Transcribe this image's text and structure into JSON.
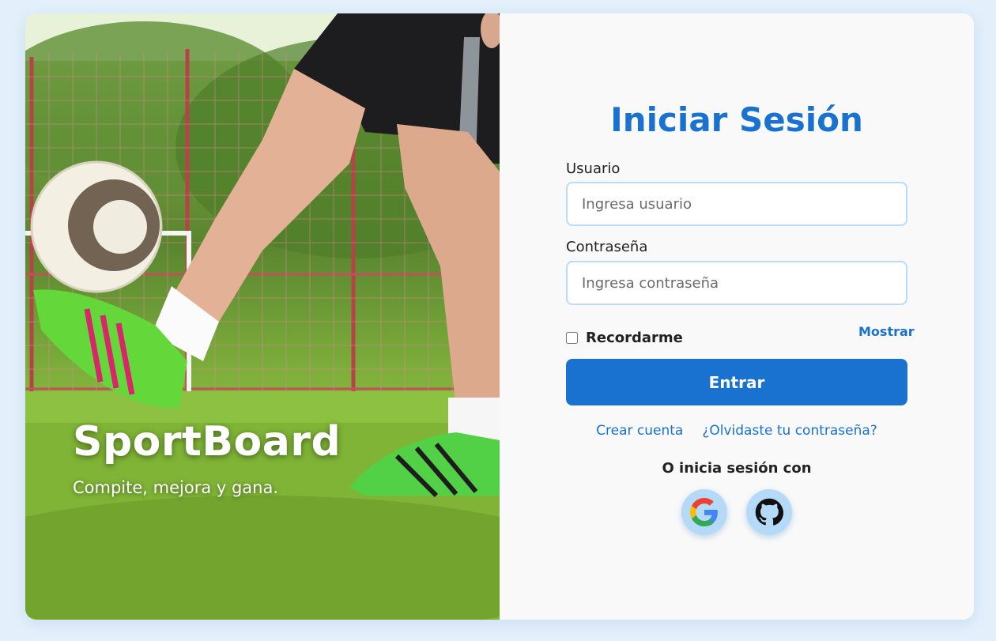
{
  "hero": {
    "brand": "SportBoard",
    "tagline": "Compite, mejora y gana."
  },
  "login": {
    "title": "Iniciar Sesión",
    "username_label": "Usuario",
    "username_placeholder": "Ingresa usuario",
    "username_value": "",
    "password_label": "Contraseña",
    "password_placeholder": "Ingresa contraseña",
    "password_value": "",
    "remember_label": "Recordarme",
    "remember_checked": false,
    "show_label": "Mostrar",
    "submit_label": "Entrar",
    "create_account": "Crear cuenta",
    "forgot_password": "¿Olvidaste tu contraseña?",
    "social_title": "O inicia sesión con",
    "social": [
      {
        "icon": "google-icon"
      },
      {
        "icon": "github-icon"
      }
    ]
  },
  "colors": {
    "accent": "#1a72d0",
    "background": "#e3f0fc",
    "panel": "#f9f9f9",
    "input_border": "#bcdcf6",
    "social_bg": "#b5daf8"
  }
}
